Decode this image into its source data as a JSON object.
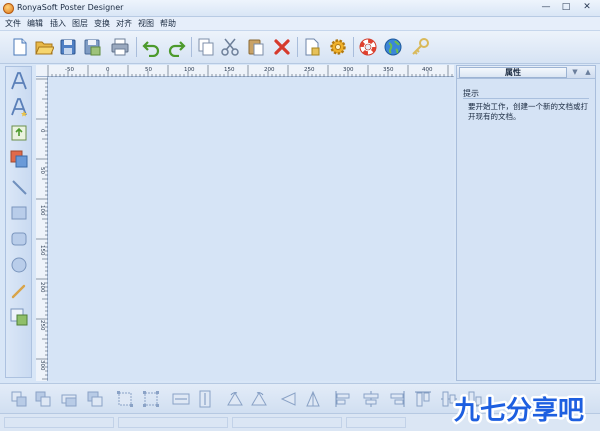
{
  "window": {
    "title": "RonyaSoft Poster Designer"
  },
  "menu": [
    {
      "label": "文件"
    },
    {
      "label": "编辑"
    },
    {
      "label": "插入"
    },
    {
      "label": "图层"
    },
    {
      "label": "变换"
    },
    {
      "label": "对齐"
    },
    {
      "label": "视图"
    },
    {
      "label": "帮助"
    }
  ],
  "toolbar": {
    "icons": [
      "new-document-icon",
      "open-folder-icon",
      "save-icon",
      "save-as-icon",
      "print-icon",
      "undo-icon",
      "redo-icon",
      "copy-icon",
      "cut-icon",
      "paste-icon",
      "delete-icon",
      "document-properties-icon",
      "settings-gear-icon",
      "help-lifebuoy-icon",
      "web-globe-icon",
      "key-icon"
    ]
  },
  "left_tools": [
    "text-icon",
    "text-effect-icon",
    "insert-image-icon",
    "image-layer-icon",
    "line-icon",
    "rectangle-icon",
    "rounded-rectangle-icon",
    "ellipse-icon",
    "pen-icon",
    "clipart-icon"
  ],
  "ruler": {
    "top_labels": [
      "-50",
      "0",
      "50",
      "100",
      "150",
      "200",
      "250",
      "300",
      "350",
      "400"
    ],
    "left_labels": [
      "0",
      "50",
      "100",
      "150",
      "200",
      "250",
      "300"
    ]
  },
  "properties_panel": {
    "title": "属性",
    "section": "提示",
    "description": "要开始工作，创建一个新的文档或打开现有的文档。"
  },
  "bottom_tools": [
    "send-to-back-icon",
    "send-backward-icon",
    "bring-forward-icon",
    "bring-to-front-icon",
    "group-icon",
    "ungroup-icon",
    "fit-width-icon",
    "fit-height-icon",
    "rotate-left-icon",
    "rotate-right-icon",
    "flip-horizontal-icon",
    "flip-vertical-icon",
    "align-left-icon",
    "align-center-icon",
    "align-right-icon",
    "align-top-icon",
    "align-middle-icon",
    "align-bottom-icon"
  ],
  "watermark": {
    "text": "九七分享吧"
  },
  "colors": {
    "accent": "#2f6fd6",
    "watermark": "#1e5fe0"
  }
}
